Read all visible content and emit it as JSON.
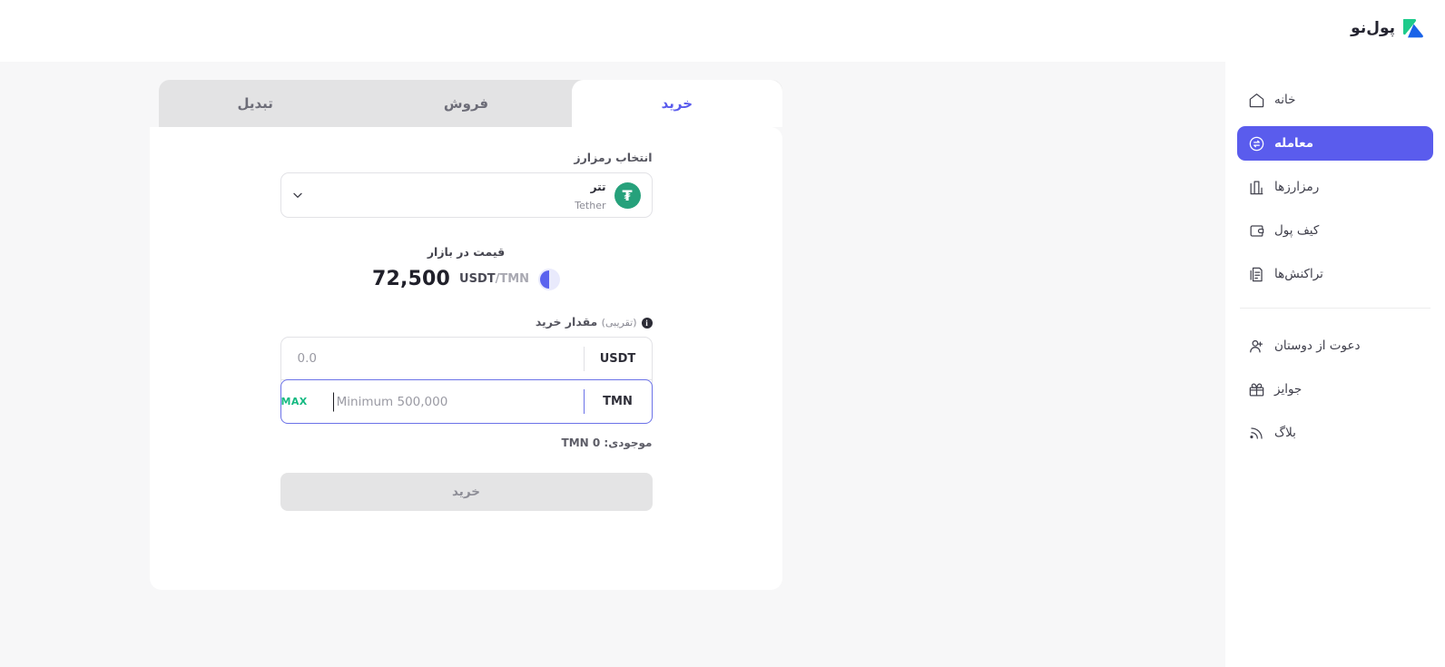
{
  "brand": {
    "name": "پول‌نو",
    "logo_icon": "poolno-logo-mark",
    "accent_color": "#5a5ced",
    "logo_green": "#1ecb8b",
    "logo_blue": "#1a63e8"
  },
  "sidebar": {
    "primary_items": [
      {
        "label": "خانه",
        "icon": "home-icon",
        "active": false
      },
      {
        "label": "معامله",
        "icon": "exchange-icon",
        "active": true
      },
      {
        "label": "رمزارزها",
        "icon": "chart-bars-icon",
        "active": false
      },
      {
        "label": "کیف پول",
        "icon": "wallet-icon",
        "active": false
      },
      {
        "label": "تراکنش‌ها",
        "icon": "transactions-icon",
        "active": false
      }
    ],
    "secondary_items": [
      {
        "label": "دعوت از دوستان",
        "icon": "invite-friends-icon",
        "active": false
      },
      {
        "label": "جوایز",
        "icon": "gift-icon",
        "active": false
      },
      {
        "label": "بلاگ",
        "icon": "rss-blog-icon",
        "active": false
      }
    ]
  },
  "trade": {
    "tabs": [
      {
        "label": "خرید",
        "active": true
      },
      {
        "label": "فروش",
        "active": false
      },
      {
        "label": "تبدیل",
        "active": false
      }
    ],
    "coin_select": {
      "label": "انتخاب رمزارز",
      "coin_name_fa": "تتر",
      "coin_name_en": "Tether",
      "coin_symbol": "₮",
      "coin_color": "#26a17b",
      "chevron_icon": "chevron-down-icon"
    },
    "market": {
      "label": "قیمت در بازار",
      "price": "72,500",
      "base": "USDT",
      "separator": "/",
      "quote": "TMN",
      "timer_icon": "refresh-timer-icon"
    },
    "amount": {
      "label": "مقدار خرید",
      "label_sub": "(تقریبی)",
      "info_icon": "info-icon",
      "info_glyph": "i",
      "rows": [
        {
          "unit": "USDT",
          "value": "",
          "placeholder": "0.0",
          "focused": false,
          "has_max": false
        },
        {
          "unit": "TMN",
          "value": "",
          "placeholder": "Minimum 500,000",
          "focused": true,
          "has_max": true,
          "max_label": "MAX",
          "max_color": "#14b981"
        }
      ]
    },
    "balance": {
      "label": "موجودی:",
      "value": "TMN 0"
    },
    "submit_label": "خرید"
  }
}
